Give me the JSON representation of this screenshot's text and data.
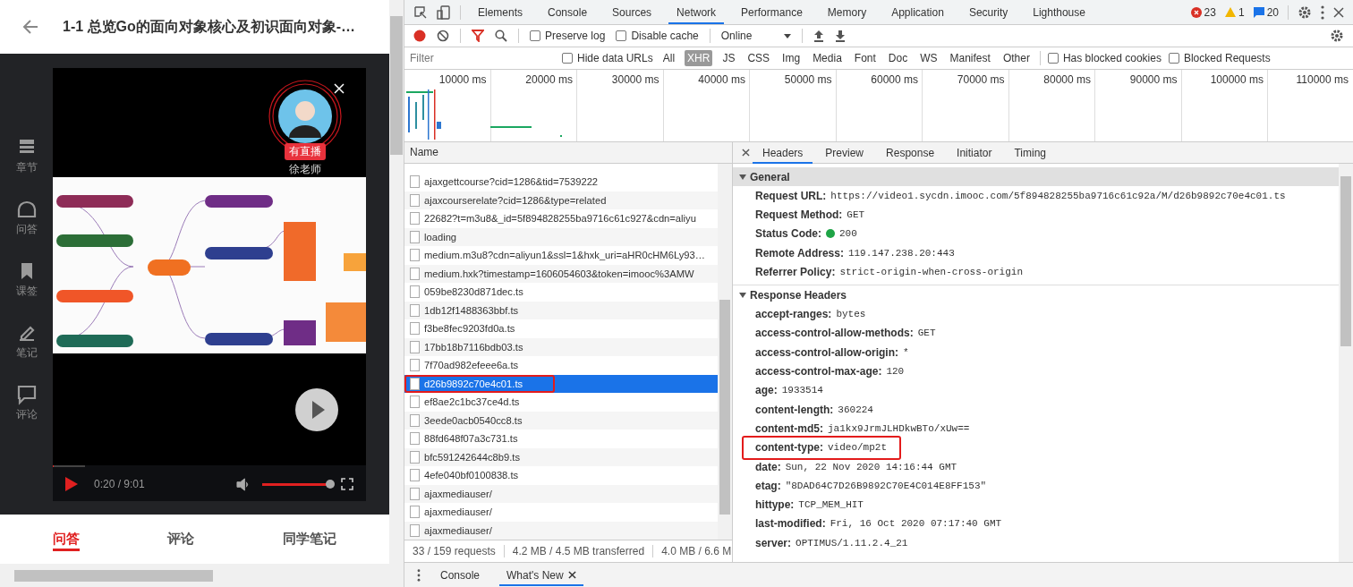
{
  "course_page": {
    "title": "1-1 总览Go的面向对象核心及初识面向对象-…",
    "side_nav": [
      {
        "label": "章节",
        "kind": "chapters"
      },
      {
        "label": "问答",
        "kind": "qa"
      },
      {
        "label": "课签",
        "kind": "bookmark"
      },
      {
        "label": "笔记",
        "kind": "note"
      },
      {
        "label": "评论",
        "kind": "comment"
      }
    ],
    "video": {
      "live_badge": "有直播",
      "teacher": "徐老师",
      "time": "0:20 / 9:01",
      "progress": {
        "level": 0.04
      },
      "volume": {
        "level": 0.95
      }
    },
    "tabs": [
      {
        "label": "问答",
        "selected": true
      },
      {
        "label": "评论",
        "selected": false
      },
      {
        "label": "同学笔记",
        "selected": false
      }
    ]
  },
  "devtools": {
    "panel_tabs": [
      {
        "label": "Elements",
        "selected": false
      },
      {
        "label": "Console",
        "selected": false
      },
      {
        "label": "Sources",
        "selected": false
      },
      {
        "label": "Network",
        "selected": true
      },
      {
        "label": "Performance",
        "selected": false
      },
      {
        "label": "Memory",
        "selected": false
      },
      {
        "label": "Application",
        "selected": false
      },
      {
        "label": "Security",
        "selected": false
      },
      {
        "label": "Lighthouse",
        "selected": false
      }
    ],
    "counts": {
      "errors": "23",
      "warnings": "1",
      "messages": "20"
    },
    "toolbar": {
      "recording": true,
      "preserve_log": {
        "label": "Preserve log",
        "checked": false
      },
      "disable_cache": {
        "label": "Disable cache",
        "checked": false
      },
      "throttling": "Online"
    },
    "filter": {
      "placeholder": "Filter",
      "hide_data_urls": {
        "label": "Hide data URLs",
        "checked": false
      },
      "types": [
        {
          "label": "All",
          "selected": false
        },
        {
          "label": "XHR",
          "selected": true
        },
        {
          "label": "JS",
          "selected": false
        },
        {
          "label": "CSS",
          "selected": false
        },
        {
          "label": "Img",
          "selected": false
        },
        {
          "label": "Media",
          "selected": false
        },
        {
          "label": "Font",
          "selected": false
        },
        {
          "label": "Doc",
          "selected": false
        },
        {
          "label": "WS",
          "selected": false
        },
        {
          "label": "Manifest",
          "selected": false
        },
        {
          "label": "Other",
          "selected": false
        }
      ],
      "has_blocked_cookies": {
        "label": "Has blocked cookies",
        "checked": false
      },
      "blocked_requests": {
        "label": "Blocked Requests",
        "checked": false
      }
    },
    "timeline": {
      "ticks": [
        "10000 ms",
        "20000 ms",
        "30000 ms",
        "40000 ms",
        "50000 ms",
        "60000 ms",
        "70000 ms",
        "80000 ms",
        "90000 ms",
        "100000 ms",
        "110000 ms"
      ]
    },
    "requests": {
      "column": "Name",
      "rows": [
        {
          "name": "ajaxgettcourse?cid=1286&tid=7539222",
          "selected": false,
          "highlighted": false
        },
        {
          "name": "ajaxcourserelate?cid=1286&type=related",
          "selected": false,
          "highlighted": false
        },
        {
          "name": "22682?t=m3u8&_id=5f894828255ba9716c61c927&cdn=aliyu",
          "selected": false,
          "highlighted": false
        },
        {
          "name": "loading",
          "selected": false,
          "highlighted": false
        },
        {
          "name": "medium.m3u8?cdn=aliyun1&ssl=1&hxk_uri=aHR0cHM6Ly93…",
          "selected": false,
          "highlighted": false
        },
        {
          "name": "medium.hxk?timestamp=1606054603&token=imooc%3AMW",
          "selected": false,
          "highlighted": false
        },
        {
          "name": "059be8230d871dec.ts",
          "selected": false,
          "highlighted": false
        },
        {
          "name": "1db12f1488363bbf.ts",
          "selected": false,
          "highlighted": false
        },
        {
          "name": "f3be8fec9203fd0a.ts",
          "selected": false,
          "highlighted": false
        },
        {
          "name": "17bb18b7116bdb03.ts",
          "selected": false,
          "highlighted": false
        },
        {
          "name": "7f70ad982efeee6a.ts",
          "selected": false,
          "highlighted": false
        },
        {
          "name": "d26b9892c70e4c01.ts",
          "selected": true,
          "highlighted": true
        },
        {
          "name": "ef8ae2c1bc37ce4d.ts",
          "selected": false,
          "highlighted": false
        },
        {
          "name": "3eede0acb0540cc8.ts",
          "selected": false,
          "highlighted": false
        },
        {
          "name": "88fd648f07a3c731.ts",
          "selected": false,
          "highlighted": false
        },
        {
          "name": "bfc591242644c8b9.ts",
          "selected": false,
          "highlighted": false
        },
        {
          "name": "4efe040bf0100838.ts",
          "selected": false,
          "highlighted": false
        },
        {
          "name": "ajaxmediauser/",
          "selected": false,
          "highlighted": false
        },
        {
          "name": "ajaxmediauser/",
          "selected": false,
          "highlighted": false
        },
        {
          "name": "ajaxmediauser/",
          "selected": false,
          "highlighted": false
        }
      ]
    },
    "status_bar": [
      "33 / 159 requests",
      "4.2 MB / 4.5 MB transferred",
      "4.0 MB / 6.6 M"
    ],
    "details": {
      "tabs": [
        {
          "label": "Headers",
          "selected": true
        },
        {
          "label": "Preview",
          "selected": false
        },
        {
          "label": "Response",
          "selected": false
        },
        {
          "label": "Initiator",
          "selected": false
        },
        {
          "label": "Timing",
          "selected": false
        }
      ],
      "sections": [
        {
          "title": "General",
          "expanded": true,
          "rows": [
            {
              "key": "Request URL:",
              "value": "https://video1.sycdn.imooc.com/5f894828255ba9716c61c92a/M/d26b9892c70e4c01.ts",
              "kind": "plain",
              "highlighted": false
            },
            {
              "key": "Request Method:",
              "value": "GET",
              "kind": "plain",
              "highlighted": false
            },
            {
              "key": "Status Code:",
              "value": "200",
              "kind": "status",
              "highlighted": false
            },
            {
              "key": "Remote Address:",
              "value": "119.147.238.20:443",
              "kind": "plain",
              "highlighted": false
            },
            {
              "key": "Referrer Policy:",
              "value": "strict-origin-when-cross-origin",
              "kind": "plain",
              "highlighted": false
            }
          ]
        },
        {
          "title": "Response Headers",
          "expanded": true,
          "rows": [
            {
              "key": "accept-ranges:",
              "value": "bytes",
              "kind": "plain",
              "highlighted": false
            },
            {
              "key": "access-control-allow-methods:",
              "value": "GET",
              "kind": "plain",
              "highlighted": false
            },
            {
              "key": "access-control-allow-origin:",
              "value": "*",
              "kind": "plain",
              "highlighted": false
            },
            {
              "key": "access-control-max-age:",
              "value": "120",
              "kind": "plain",
              "highlighted": false
            },
            {
              "key": "age:",
              "value": "1933514",
              "kind": "plain",
              "highlighted": false
            },
            {
              "key": "content-length:",
              "value": "360224",
              "kind": "plain",
              "highlighted": false
            },
            {
              "key": "content-md5:",
              "value": "ja1kx9JrmJLHDkwBTo/xUw==",
              "kind": "plain",
              "highlighted": false
            },
            {
              "key": "content-type:",
              "value": "video/mp2t",
              "kind": "plain",
              "highlighted": true
            },
            {
              "key": "date:",
              "value": "Sun, 22 Nov 2020 14:16:44 GMT",
              "kind": "plain",
              "highlighted": false
            },
            {
              "key": "etag:",
              "value": "\"8DAD64C7D26B9892C70E4C014E8FF153\"",
              "kind": "plain",
              "highlighted": false
            },
            {
              "key": "hittype:",
              "value": "TCP_MEM_HIT",
              "kind": "plain",
              "highlighted": false
            },
            {
              "key": "last-modified:",
              "value": "Fri, 16 Oct 2020 07:17:40 GMT",
              "kind": "plain",
              "highlighted": false
            },
            {
              "key": "server:",
              "value": "OPTIMUS/1.11.2.4_21",
              "kind": "plain",
              "highlighted": false
            }
          ]
        }
      ]
    },
    "drawer": {
      "tabs": [
        {
          "label": "Console",
          "selected": false,
          "closable": false
        },
        {
          "label": "What's New",
          "selected": true,
          "closable": true
        }
      ]
    }
  }
}
